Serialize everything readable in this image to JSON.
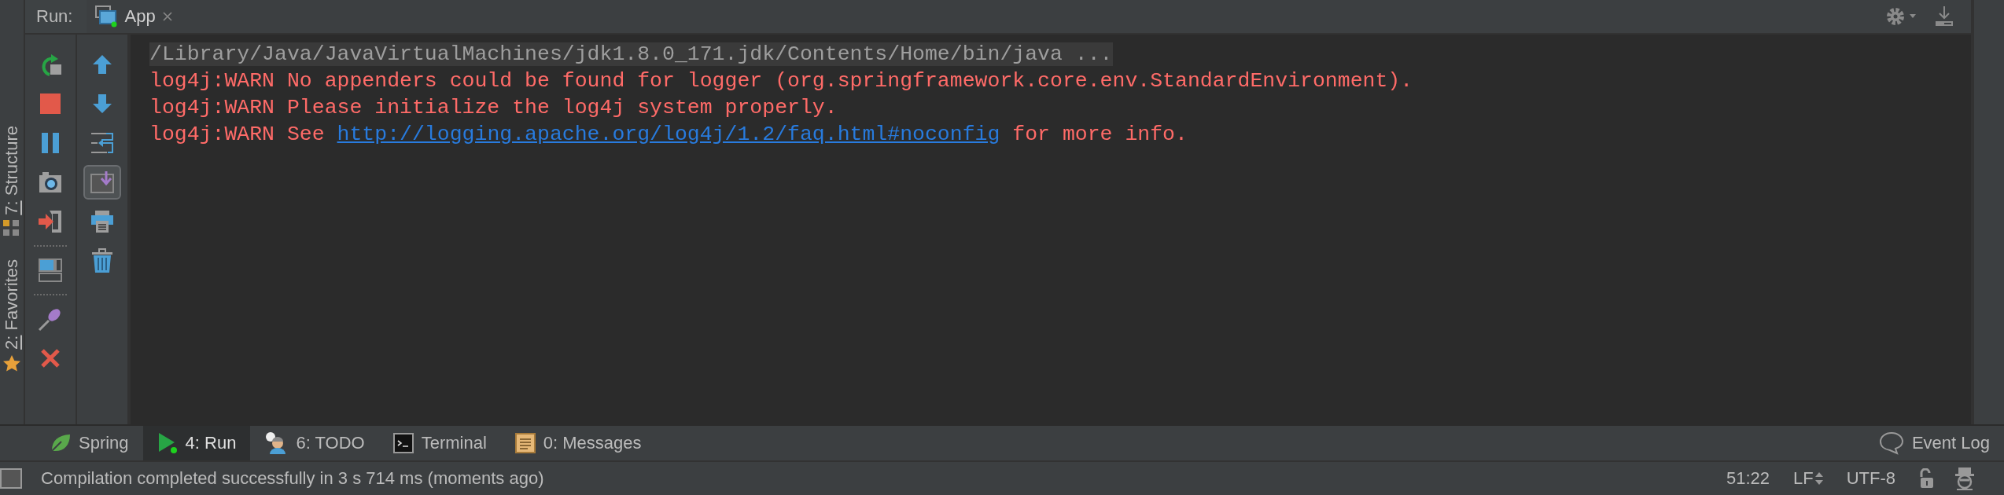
{
  "left_strip": [
    {
      "label": "7: Structure"
    },
    {
      "label": "2: Favorites"
    }
  ],
  "run_header": {
    "label": "Run:",
    "tab": {
      "label": "App",
      "selected": true
    }
  },
  "console_toolbar": [
    {
      "toggled": false
    },
    {
      "toggled": false
    },
    {
      "toggled": false
    },
    {
      "toggled": true
    },
    {
      "toggled": false
    },
    {
      "toggled": false
    }
  ],
  "console": {
    "command": "/Library/Java/JavaVirtualMachines/jdk1.8.0_171.jdk/Contents/Home/bin/java ...",
    "lines": [
      {
        "text": "log4j:WARN No appenders could be found for logger (org.springframework.core.env.StandardEnvironment)."
      },
      {
        "text": "log4j:WARN Please initialize the log4j system properly."
      },
      {
        "text": "log4j:WARN See ",
        "link": "http://logging.apache.org/log4j/1.2/faq.html#noconfig",
        "after": " for more info."
      }
    ]
  },
  "tool_tabs": [
    {
      "label": "Spring",
      "selected": false
    },
    {
      "label": "4: Run",
      "selected": true
    },
    {
      "label": "6: TODO",
      "selected": false
    },
    {
      "label": "Terminal",
      "selected": false
    },
    {
      "label": "0: Messages",
      "selected": false
    }
  ],
  "event_log": "Event Log",
  "status_bar": {
    "message": "Compilation completed successfully in 3 s 714 ms (moments ago)",
    "position": "51:22",
    "line_separator": "LF",
    "encoding": "UTF-8"
  }
}
